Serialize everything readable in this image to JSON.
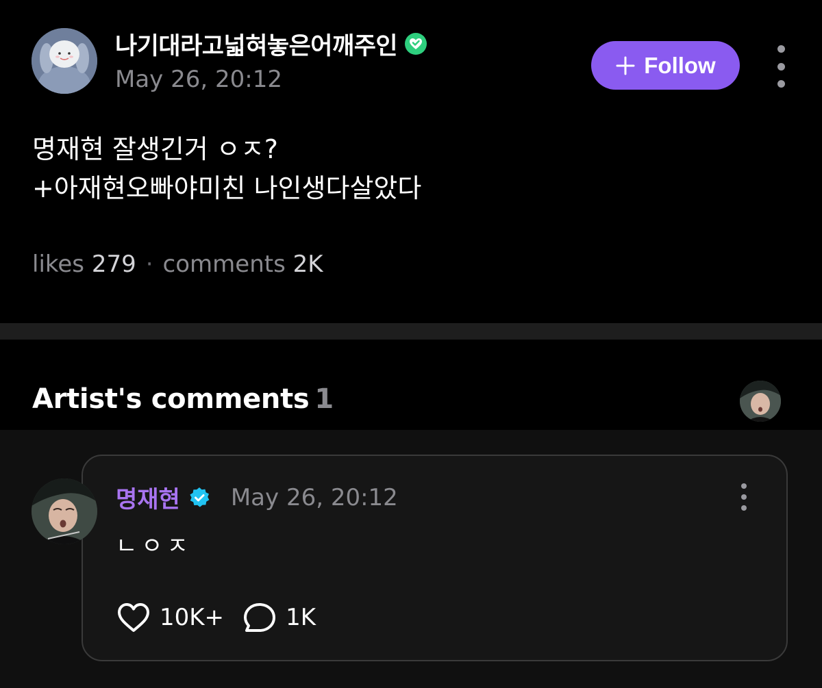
{
  "post": {
    "author": "나기대라고넓혀놓은어깨주인",
    "timestamp": "May 26, 20:12",
    "author_verified_icon": "green-heart-check-badge-icon",
    "follow_label": "Follow",
    "follow_color": "#8a5bf0",
    "body_lines": [
      "명재현 잘생긴거 ㅇㅈ?",
      "+아재현오빠야미친 나인생다살았다"
    ],
    "stats": {
      "likes_label": "likes",
      "likes_count": "279",
      "separator": "·",
      "comments_label": "comments",
      "comments_count": "2K"
    }
  },
  "artist_comments": {
    "title": "Artist's comments",
    "count": "1"
  },
  "comment": {
    "author": "명재현",
    "author_color": "#a874f0",
    "verified_icon": "blue-verified-badge-icon",
    "timestamp": "May 26, 20:12",
    "text": "ㄴㅇㅈ",
    "likes": "10K+",
    "replies": "1K"
  }
}
